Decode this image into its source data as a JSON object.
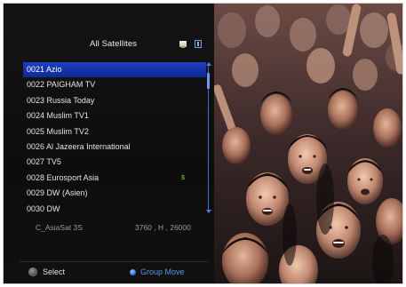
{
  "panel": {
    "title": "All Satellites",
    "channels": [
      {
        "number": "0021",
        "name": "Azio",
        "selected": true
      },
      {
        "number": "0022",
        "name": "PAIGHAM TV"
      },
      {
        "number": "0023",
        "name": "Russia Today"
      },
      {
        "number": "0024",
        "name": "Muslim TV1"
      },
      {
        "number": "0025",
        "name": "Muslim TV2"
      },
      {
        "number": "0026",
        "name": "Al Jazeera International"
      },
      {
        "number": "0027",
        "name": "TV5"
      },
      {
        "number": "0028",
        "name": "Eurosport Asia",
        "mark": "$"
      },
      {
        "number": "0029",
        "name": "DW (Asien)"
      },
      {
        "number": "0030",
        "name": "DW"
      }
    ],
    "satellite": {
      "name": "C_AsiaSat 3S",
      "params": "3760 , H , 26000"
    },
    "footer": {
      "select_label": "Select",
      "group_move_label": "Group Move"
    }
  },
  "colors": {
    "selection": "#1a3ab8",
    "accent_blue": "#5d93ec",
    "scrambled_mark": "#7fd14a"
  },
  "video": {
    "content": "crowd-concert-video"
  }
}
